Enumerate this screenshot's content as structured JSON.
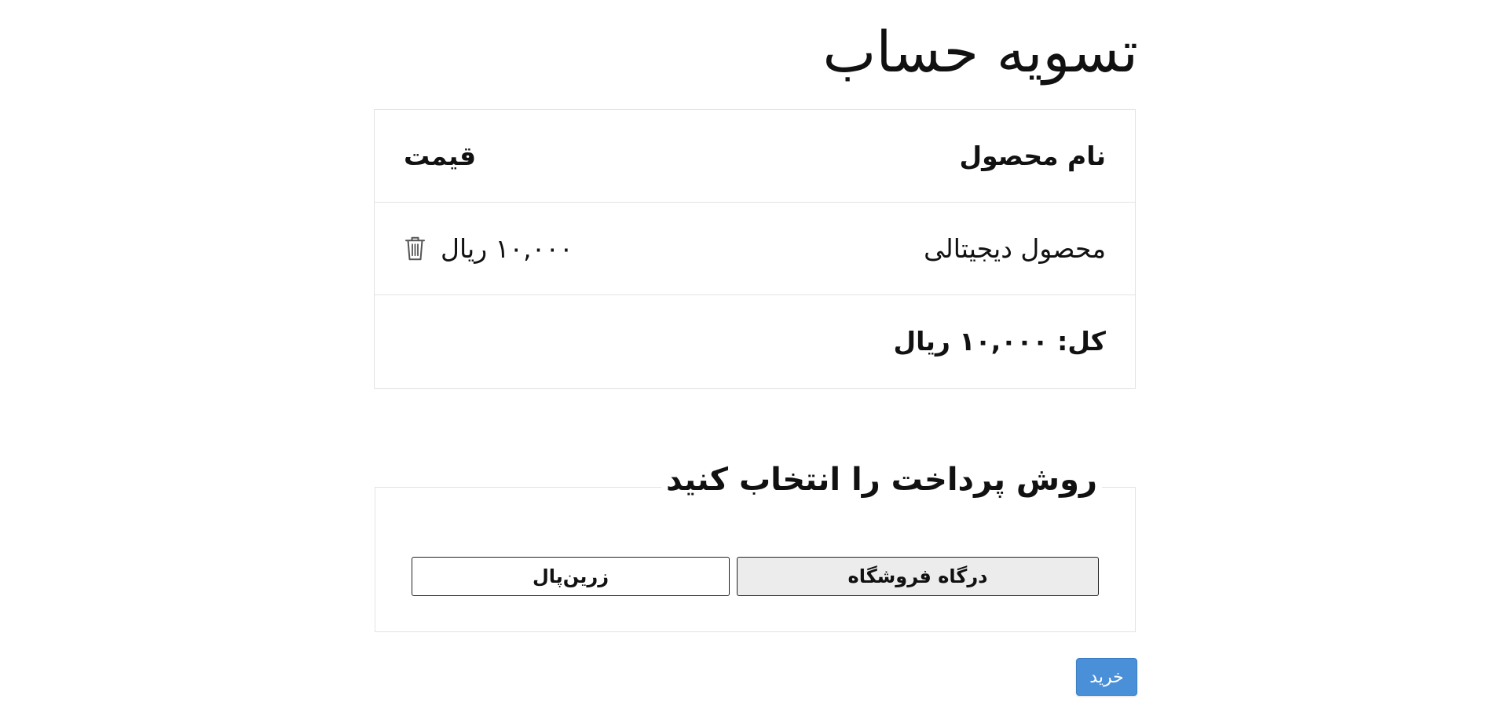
{
  "page": {
    "title": "تسویه حساب"
  },
  "cart": {
    "header": {
      "product_name": "نام محصول",
      "price": "قیمت"
    },
    "items": [
      {
        "name": "محصول دیجیتالی",
        "price": "۱۰,۰۰۰ ریال",
        "remove_icon": "trash-icon"
      }
    ],
    "total": "کل: ۱۰,۰۰۰ ریال"
  },
  "payment": {
    "legend": "روش پرداخت را انتخاب کنید",
    "methods": [
      {
        "label": "درگاه فروشگاه",
        "selected": true
      },
      {
        "label": "زرین‌پال",
        "selected": false
      }
    ]
  },
  "actions": {
    "buy_label": "خرید"
  },
  "colors": {
    "buy_button": "#4a90d9",
    "selected_method_bg": "#ececec",
    "border": "#e3e3e3"
  }
}
